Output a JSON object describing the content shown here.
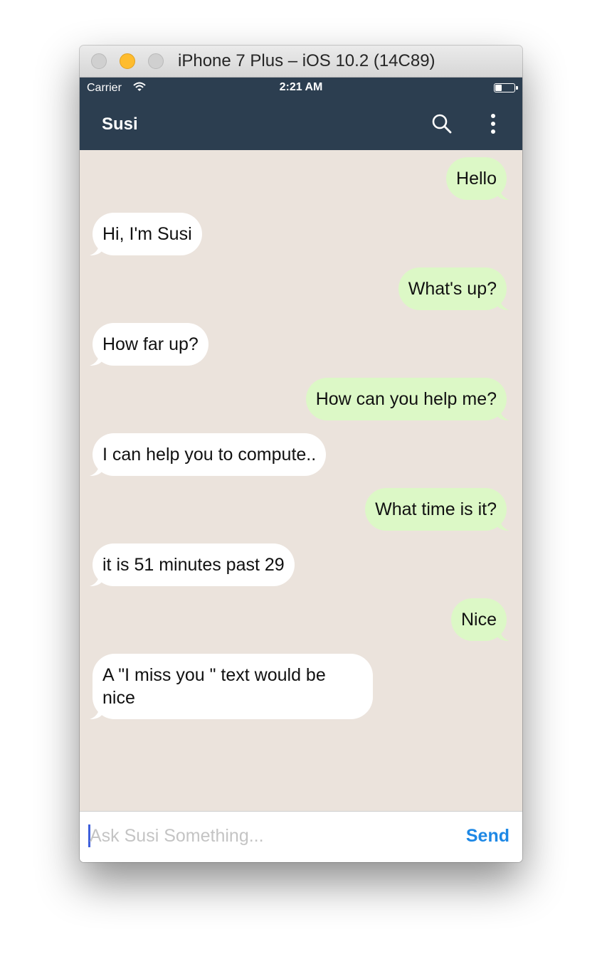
{
  "window": {
    "title": "iPhone 7 Plus – iOS 10.2 (14C89)"
  },
  "status_bar": {
    "carrier": "Carrier",
    "time": "2:21 AM"
  },
  "app_bar": {
    "title": "Susi",
    "search_icon": "search-icon",
    "menu_icon": "more-vert-icon"
  },
  "colors": {
    "app_bar": "#2c3e50",
    "chat_background": "#ebe3dc",
    "outgoing_bubble": "#dcf8c6",
    "incoming_bubble": "#ffffff",
    "send_accent": "#1e88e5"
  },
  "messages": [
    {
      "sender": "user",
      "text": "Hello"
    },
    {
      "sender": "susi",
      "text": "Hi, I'm Susi"
    },
    {
      "sender": "user",
      "text": "What's up?"
    },
    {
      "sender": "susi",
      "text": "How far up?"
    },
    {
      "sender": "user",
      "text": "How can you help me?"
    },
    {
      "sender": "susi",
      "text": "I can help you to compute.."
    },
    {
      "sender": "user",
      "text": "What time is it?"
    },
    {
      "sender": "susi",
      "text": "it is 51 minutes past 29"
    },
    {
      "sender": "user",
      "text": "Nice"
    },
    {
      "sender": "susi",
      "text": "A \"I miss you \" text would be nice"
    }
  ],
  "composer": {
    "placeholder": "Ask Susi Something...",
    "value": "",
    "send_label": "Send"
  }
}
